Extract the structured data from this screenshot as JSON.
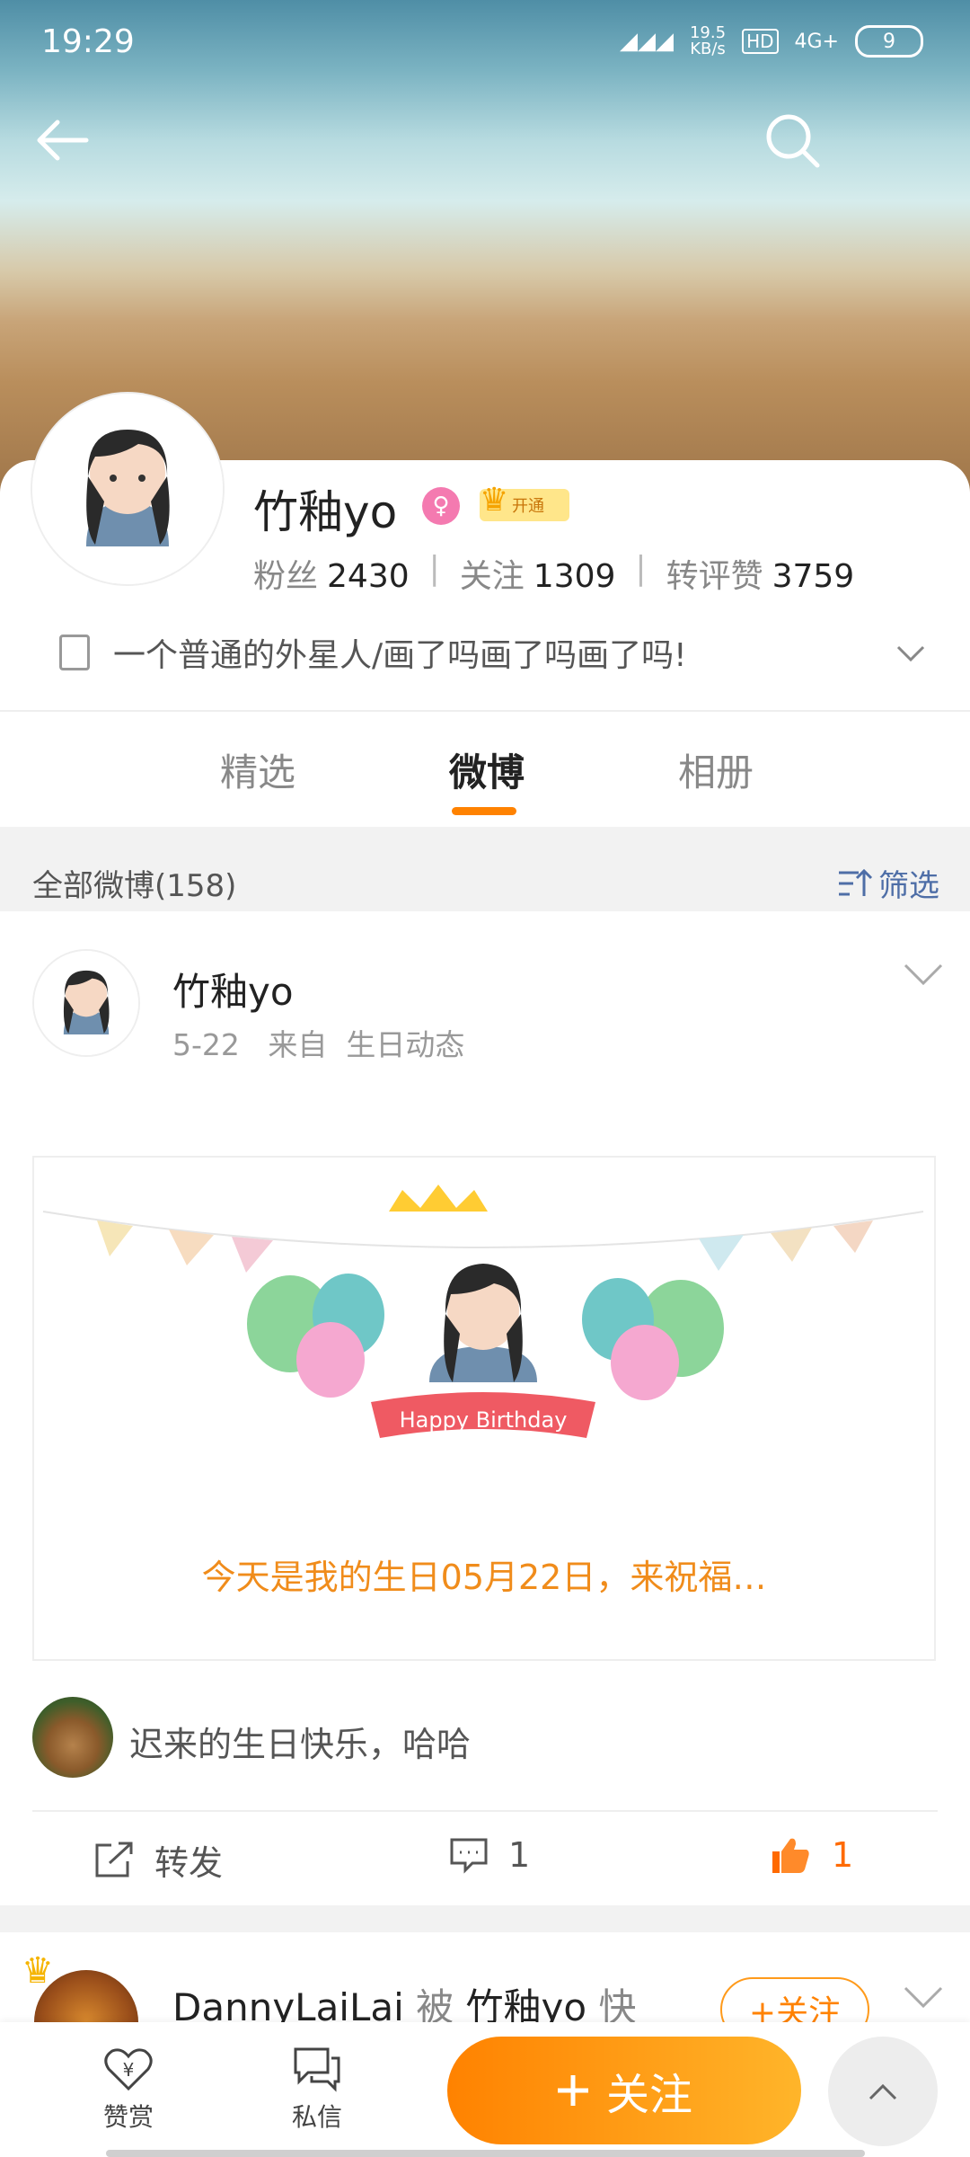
{
  "status_bar": {
    "time": "19:29",
    "speed": "19.5\nKB/s",
    "hd": "HD",
    "network": "4G+",
    "battery": "9"
  },
  "header": {
    "back_icon": "arrow-left-icon",
    "search_icon": "search-icon"
  },
  "profile": {
    "name": "竹釉yo",
    "vip_label": "开通",
    "stats": [
      {
        "label": "粉丝",
        "value": "2430"
      },
      {
        "label": "关注",
        "value": "1309"
      },
      {
        "label": "转评赞",
        "value": "3759"
      }
    ],
    "bio": "一个普通的外星人/画了吗画了吗画了吗!"
  },
  "tabs": [
    {
      "label": "精选"
    },
    {
      "label": "微博",
      "active": true
    },
    {
      "label": "相册"
    }
  ],
  "filter": {
    "all_label": "全部微博(158)",
    "filter_label": "筛选"
  },
  "post": {
    "author": "竹釉yo",
    "date": "5-22",
    "source_prefix": "来自",
    "source": "生日动态",
    "card_text": "今天是我的生日05月22日，来祝福…",
    "banner_text": "Happy Birthday",
    "comment_preview": "迟来的生日快乐，哈哈",
    "actions": {
      "repost": "转发",
      "comments": "1",
      "likes": "1"
    }
  },
  "next_post": {
    "author": "DannyLaiLai",
    "connector": "被",
    "target": "竹釉yo",
    "tail": "快",
    "follow_label": "+关注"
  },
  "bottom_bar": {
    "reward": "赞赏",
    "message": "私信",
    "follow": "关注"
  },
  "colors": {
    "accent": "#ff8200",
    "link": "#4e6ea7",
    "like": "#ff6a00"
  }
}
